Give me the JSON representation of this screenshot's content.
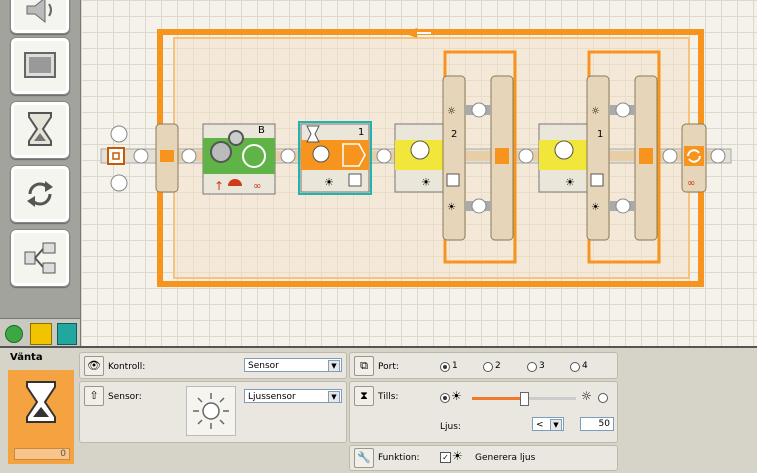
{
  "colors": {
    "accent": "#f7941d",
    "palette_bg": "#a3a39d",
    "block_orange": "#f5a340"
  },
  "palette": {
    "items": [
      {
        "name": "sound-icon"
      },
      {
        "name": "display-icon"
      },
      {
        "name": "wait-icon"
      },
      {
        "name": "loop-icon"
      },
      {
        "name": "switch-icon"
      }
    ]
  },
  "canvas": {
    "motor_block": {
      "port": "B"
    },
    "wait_block": {
      "port": "1"
    },
    "switch1": {
      "port": "2"
    },
    "switch2": {
      "port": "1"
    }
  },
  "config": {
    "block_title": "Vänta",
    "block_count": "0",
    "control": {
      "label": "Kontroll:",
      "value": "Sensor"
    },
    "sensor": {
      "label": "Sensor:",
      "value": "Ljussensor"
    },
    "port": {
      "label": "Port:",
      "options": [
        "1",
        "2",
        "3",
        "4"
      ],
      "selected": "1"
    },
    "until": {
      "label": "Tills:",
      "slider_fraction": 0.5
    },
    "light": {
      "label": "Ljus:",
      "operator": "<",
      "value": "50"
    },
    "function": {
      "label": "Funktion:",
      "checkbox_label": "Generera ljus",
      "checked": true
    }
  }
}
